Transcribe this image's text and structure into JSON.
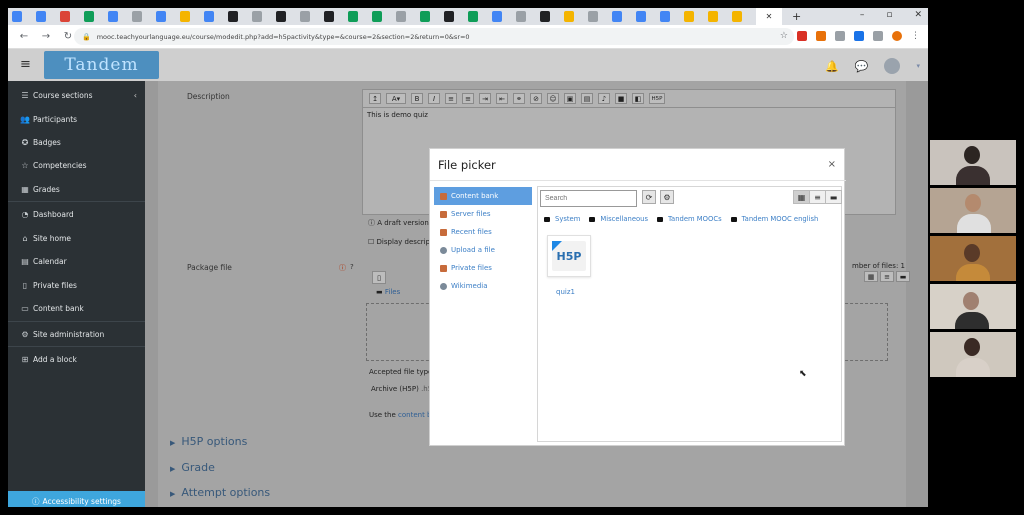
{
  "browser": {
    "url": "mooc.teachyourlanguage.eu/course/modedit.php?add=h5pactivity&type=&course=2&section=2&return=0&sr=0",
    "new_tab": "+",
    "window_controls": [
      "–",
      "▫",
      "✕"
    ]
  },
  "site": {
    "logo_text": "Tandem"
  },
  "drawer": {
    "items": [
      {
        "label": "Course sections",
        "icon": "list-icon"
      },
      {
        "label": "Participants",
        "icon": "users-icon"
      },
      {
        "label": "Badges",
        "icon": "badge-icon"
      },
      {
        "label": "Competencies",
        "icon": "star-icon"
      },
      {
        "label": "Grades",
        "icon": "table-icon"
      },
      {
        "label": "Dashboard",
        "icon": "dashboard-icon"
      },
      {
        "label": "Site home",
        "icon": "home-icon"
      },
      {
        "label": "Calendar",
        "icon": "calendar-icon"
      },
      {
        "label": "Private files",
        "icon": "file-icon"
      },
      {
        "label": "Content bank",
        "icon": "bank-icon"
      },
      {
        "label": "Site administration",
        "icon": "gear-icon"
      },
      {
        "label": "Add a block",
        "icon": "plus-square-icon"
      }
    ],
    "accessibility": "Accessibility settings"
  },
  "form": {
    "description_label": "Description",
    "description_text": "This is demo quiz",
    "draft_notice": "A draft version",
    "display_description": "Display descript",
    "package_file_label": "Package file",
    "max_files": "mber of files: 1",
    "files_label": "Files",
    "accepted_types": "Accepted file types",
    "archive": "Archive (H5P)",
    "archive_ext": ".h5p",
    "use_the": "Use the",
    "content_bank_link": "content bc",
    "sections": [
      "H5P options",
      "Grade",
      "Attempt options"
    ]
  },
  "file_picker": {
    "title": "File picker",
    "close": "×",
    "repositories": [
      {
        "label": "Content bank",
        "active": true
      },
      {
        "label": "Server files",
        "active": false
      },
      {
        "label": "Recent files",
        "active": false
      },
      {
        "label": "Upload a file",
        "active": false
      },
      {
        "label": "Private files",
        "active": false
      },
      {
        "label": "Wikimedia",
        "active": false
      }
    ],
    "search_placeholder": "Search",
    "breadcrumb": [
      "System",
      "Miscellaneous",
      "Tandem MOOCs",
      "Tandem MOOC english"
    ],
    "file": {
      "name": "quiz1",
      "type_label": "H5P"
    }
  },
  "colors": {
    "accent": "#3ea6dd",
    "link": "#3c7fc6",
    "drawer_bg": "#2b3135",
    "active_repo": "#5e9ee0"
  }
}
